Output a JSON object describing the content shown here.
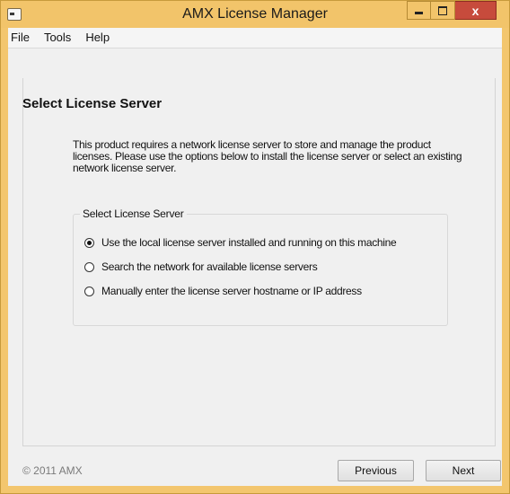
{
  "window": {
    "title": "AMX License Manager",
    "icon": "app-icon",
    "controls": {
      "minimize": "minimize-icon",
      "maximize": "maximize-icon",
      "close": "x"
    }
  },
  "menu": {
    "items": [
      {
        "label": "File"
      },
      {
        "label": "Tools"
      },
      {
        "label": "Help"
      }
    ]
  },
  "page": {
    "title": "Select License Server",
    "description": "This product requires a network license server to store and manage the product licenses.  Please use the options below to install the license server or select an existing network license server."
  },
  "license_group": {
    "label": "Select License Server",
    "options": [
      {
        "label": "Use the local license server installed and running on this machine",
        "selected": true
      },
      {
        "label": "Search the network for available license servers",
        "selected": false
      },
      {
        "label": "Manually enter the license server hostname or IP address",
        "selected": false
      }
    ]
  },
  "footer": {
    "copyright": "© 2011 AMX",
    "previous_label": "Previous",
    "next_label": "Next"
  },
  "colors": {
    "titlebar": "#f2c46a",
    "close_button": "#c74b3c",
    "client_background": "#f0f0f0"
  }
}
